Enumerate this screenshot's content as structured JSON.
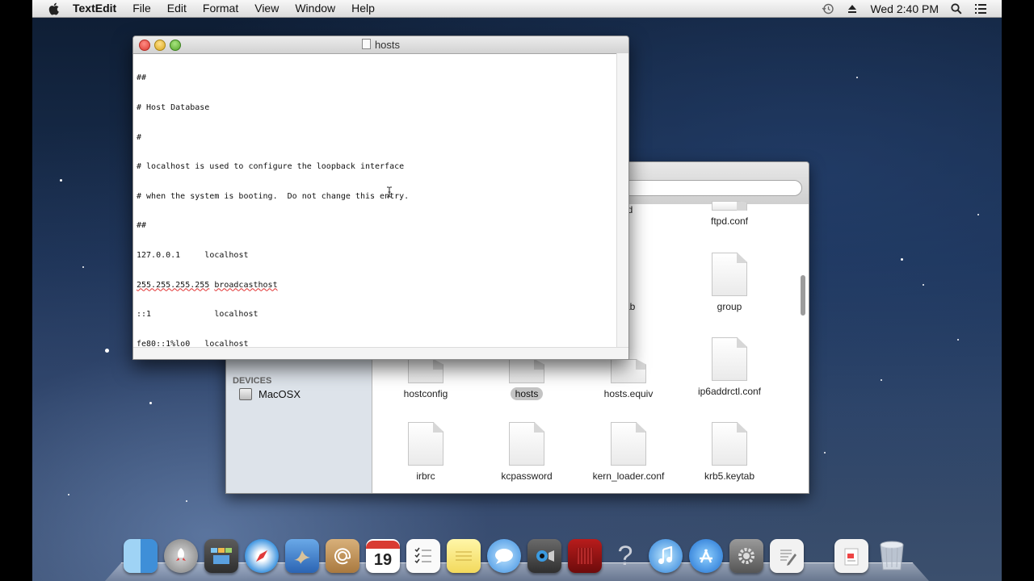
{
  "menubar": {
    "app_name": "TextEdit",
    "items": [
      "File",
      "Edit",
      "Format",
      "View",
      "Window",
      "Help"
    ],
    "clock": "Wed 2:40 PM"
  },
  "textedit": {
    "title": "hosts",
    "lines": [
      "##",
      "# Host Database",
      "#",
      "# localhost is used to configure the loopback interface",
      "# when the system is booting.  Do not change this entry.",
      "##",
      "127.0.0.1\tlocalhost",
      "255.255.255.255\tbroadcasthost",
      "::1             localhost",
      "fe80::1%lo0\tlocalhost"
    ]
  },
  "finder": {
    "sidebar": {
      "section": "DEVICES",
      "device": "MacOSX"
    },
    "files": [
      {
        "name": ".hd",
        "selected": false
      },
      {
        "name": "ftpd.conf",
        "selected": false
      },
      {
        "name": "ytab",
        "selected": false
      },
      {
        "name": "group",
        "selected": false
      },
      {
        "name": "hostconfig",
        "selected": false
      },
      {
        "name": "hosts",
        "selected": true
      },
      {
        "name": "hosts.equiv",
        "selected": false
      },
      {
        "name": "ip6addrctl.conf",
        "selected": false
      },
      {
        "name": "irbrc",
        "selected": false
      },
      {
        "name": "kcpassword",
        "selected": false
      },
      {
        "name": "kern_loader.conf",
        "selected": false
      },
      {
        "name": "krb5.keytab",
        "selected": false
      }
    ]
  },
  "dock": {
    "icons": [
      "finder-icon",
      "launchpad-icon",
      "mission-control-icon",
      "safari-icon",
      "mail-icon",
      "contacts-icon",
      "calendar-icon",
      "reminders-icon",
      "notes-icon",
      "messages-icon",
      "facetime-icon",
      "photo-booth-icon",
      "help-icon",
      "itunes-icon",
      "app-store-icon",
      "system-preferences-icon",
      "textedit-icon",
      "documents-stack-icon",
      "trash-icon"
    ],
    "calendar_day": "19"
  }
}
